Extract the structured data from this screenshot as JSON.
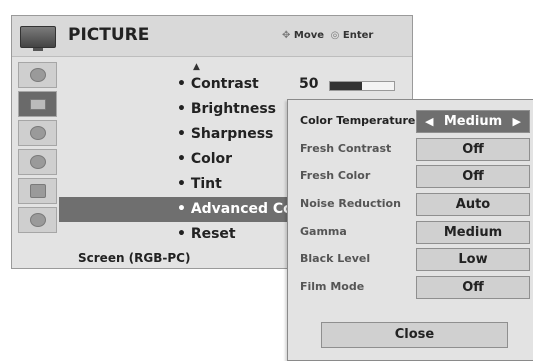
{
  "header": {
    "title": "PICTURE",
    "move_label": "Move",
    "enter_label": "Enter"
  },
  "menu": {
    "items": [
      {
        "label": "• Contrast",
        "value": "50",
        "bar_fraction": 0.5
      },
      {
        "label": "• Brightness"
      },
      {
        "label": "• Sharpness"
      },
      {
        "label": "• Color"
      },
      {
        "label": "• Tint"
      },
      {
        "label": "• Advanced Co"
      },
      {
        "label": "• Reset"
      }
    ],
    "footer": "Screen (RGB-PC)"
  },
  "submenu": {
    "rows": [
      {
        "label": "Color Temperature",
        "value": "Medium"
      },
      {
        "label": "Fresh Contrast",
        "value": "Off"
      },
      {
        "label": "Fresh Color",
        "value": "Off"
      },
      {
        "label": "Noise Reduction",
        "value": "Auto"
      },
      {
        "label": "Gamma",
        "value": "Medium"
      },
      {
        "label": "Black Level",
        "value": "Low"
      },
      {
        "label": "Film Mode",
        "value": "Off"
      }
    ],
    "close_label": "Close"
  }
}
